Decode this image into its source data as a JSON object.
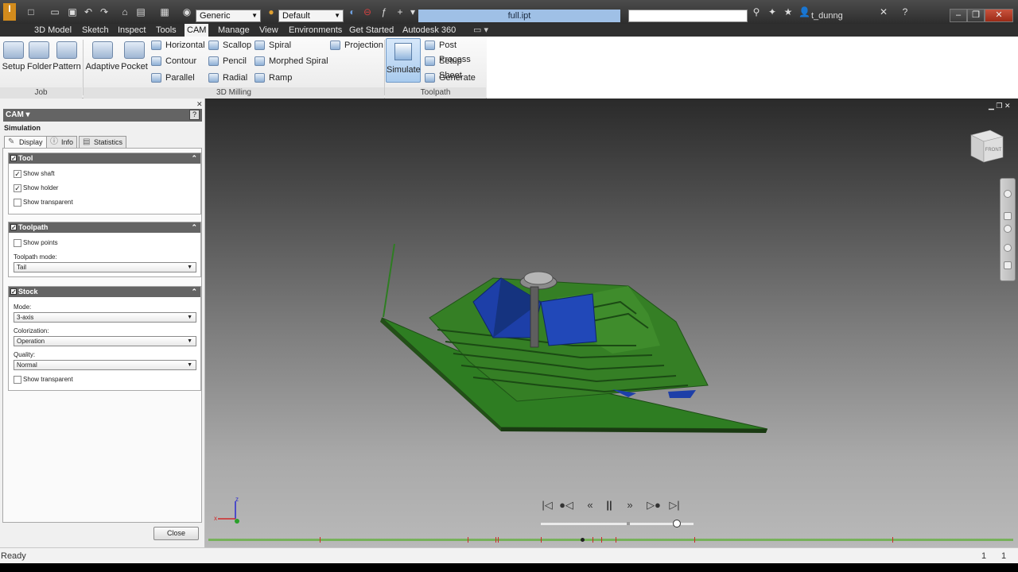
{
  "title_bar": {
    "doc_title": "full.ipt",
    "material": "Generic",
    "appearance": "Default",
    "user": "t_dunng"
  },
  "tabs": [
    {
      "label": "3D Model"
    },
    {
      "label": "Sketch"
    },
    {
      "label": "Inspect"
    },
    {
      "label": "Tools"
    },
    {
      "label": "CAM"
    },
    {
      "label": "Manage"
    },
    {
      "label": "View"
    },
    {
      "label": "Environments"
    },
    {
      "label": "Get Started"
    },
    {
      "label": "Autodesk 360"
    }
  ],
  "ribbon": {
    "groups": {
      "job": "Job",
      "milling": "3D Milling",
      "toolpath": "Toolpath"
    },
    "job_buttons": [
      "Setup",
      "Folder",
      "Pattern"
    ],
    "big_buttons": [
      "Adaptive",
      "Pocket"
    ],
    "col1": [
      "Horizontal",
      "Contour",
      "Parallel"
    ],
    "col2": [
      "Scallop",
      "Pencil",
      "Radial"
    ],
    "col3": [
      "Spiral",
      "Morphed Spiral",
      "Ramp"
    ],
    "projection": "Projection",
    "simulate": "Simulate",
    "toolpath_items": [
      "Post Process",
      "Setup Sheet",
      "Generate"
    ]
  },
  "panel": {
    "header": "CAM ▾",
    "help": "?",
    "subtitle": "Simulation",
    "tabs": [
      "Display",
      "Info",
      "Statistics"
    ],
    "tool": {
      "title": "Tool",
      "show_shaft": "Show shaft",
      "show_holder": "Show holder",
      "show_transparent": "Show transparent"
    },
    "toolpath": {
      "title": "Toolpath",
      "show_points": "Show points",
      "mode_label": "Toolpath mode:",
      "mode_value": "Tail"
    },
    "stock": {
      "title": "Stock",
      "mode_label": "Mode:",
      "mode_value": "3-axis",
      "colorization_label": "Colorization:",
      "colorization_value": "Operation",
      "quality_label": "Quality:",
      "quality_value": "Normal",
      "show_transparent": "Show transparent"
    },
    "close": "Close"
  },
  "viewcube": {
    "face": "FRONT"
  },
  "status": {
    "text": "Ready",
    "count1": "1",
    "count2": "1"
  },
  "colors": {
    "stock_green": "#2e7d22",
    "stock_blue": "#1d3fa8",
    "timeline": "#77b15a",
    "timeline_mark": "#cc2b2b"
  },
  "playback": {
    "buttons": [
      "first",
      "prev-step",
      "rewind",
      "pause",
      "forward",
      "next-step",
      "last"
    ],
    "position": 0.88
  }
}
